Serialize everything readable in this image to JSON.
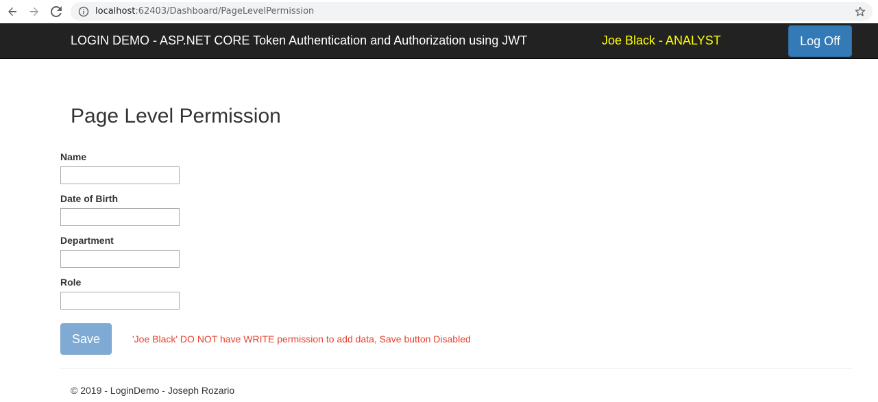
{
  "browser": {
    "url_host": "localhost",
    "url_rest": ":62403/Dashboard/PageLevelPermission",
    "icons": {
      "back": "arrow-left-icon",
      "forward": "arrow-right-icon",
      "reload": "reload-icon",
      "info": "info-icon",
      "bookmark": "star-icon"
    }
  },
  "navbar": {
    "brand": "LOGIN DEMO - ASP.NET CORE Token Authentication and Authorization using JWT",
    "user": "Joe Black - ANALYST",
    "logoff_label": "Log Off",
    "colors": {
      "background": "#222222",
      "brand_text": "#ffffff",
      "user_text": "#ffff00",
      "logoff_button": "#337ab7"
    }
  },
  "main": {
    "title": "Page Level Permission",
    "fields": [
      {
        "label": "Name",
        "value": ""
      },
      {
        "label": "Date of Birth",
        "value": ""
      },
      {
        "label": "Department",
        "value": ""
      },
      {
        "label": "Role",
        "value": ""
      }
    ],
    "save_label": "Save",
    "save_disabled": true,
    "warning": "'Joe Black' DO NOT have WRITE permission to add data, Save button Disabled",
    "warning_color": "#e8412c"
  },
  "footer": {
    "text": "© 2019 - LoginDemo - Joseph Rozario"
  }
}
